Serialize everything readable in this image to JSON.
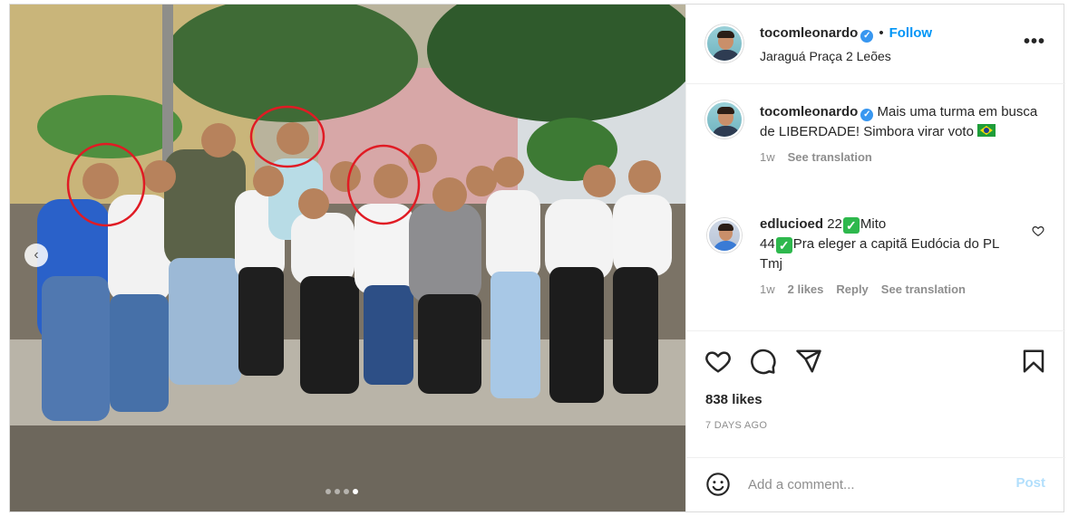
{
  "post": {
    "username": "tocomleonardo",
    "follow_label": "Follow",
    "bullet": "•",
    "location": "Jaraguá Praça 2 Leões",
    "more_label": "•••"
  },
  "caption": {
    "username": "tocomleonardo",
    "text": "Mais uma turma em busca de LIBERDADE! Simbora virar voto",
    "time": "1w",
    "see_translation": "See translation"
  },
  "comment": {
    "username": "edlucioed",
    "text_1": "22",
    "text_2": "Mito",
    "text_3": "44",
    "text_4": "Pra eleger a capitã Eudócia do PL",
    "text_5": "Tmj",
    "time": "1w",
    "likes": "2 likes",
    "reply": "Reply",
    "see_translation": "See translation"
  },
  "engagement": {
    "likes": "838 likes",
    "date": "7 DAYS AGO"
  },
  "add_comment": {
    "placeholder": "Add a comment...",
    "post_label": "Post"
  },
  "carousel": {
    "prev_label": "‹",
    "dot_count": 4,
    "active_index": 3
  },
  "colors": {
    "follow": "#0095f6",
    "verified": "#3897f0",
    "post_disabled": "#b2dffc",
    "annotation_circle": "#e01b24"
  },
  "icons": [
    "verified-badge-icon",
    "more-options-icon",
    "heart-icon",
    "comment-icon",
    "share-icon",
    "save-icon",
    "emoji-icon",
    "chevron-left-icon",
    "brazil-flag-icon",
    "check-mark-icon"
  ]
}
